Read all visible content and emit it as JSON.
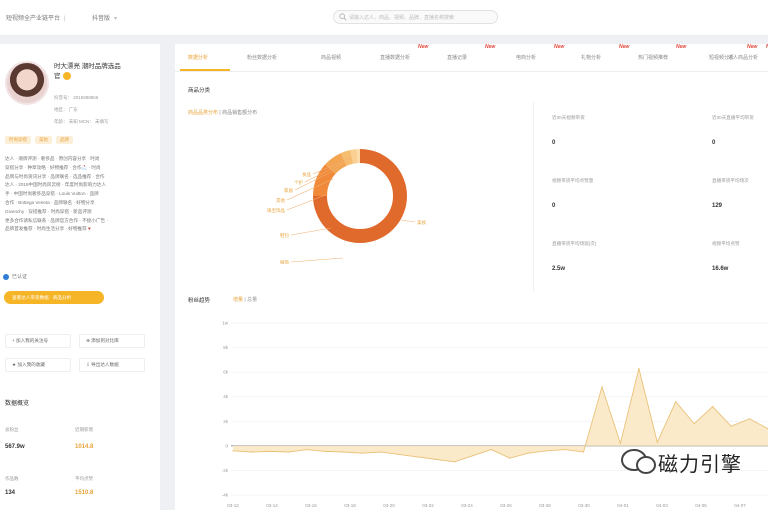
{
  "topbar": {
    "crumbs": [
      "短视频全产业链平台",
      "抖音版"
    ],
    "search_placeholder": "请输入达人、商品、视频、品牌、直播名称搜索"
  },
  "profile": {
    "name": "时大漂亮 潮时品牌选品",
    "name_tail": "官",
    "meta1": "抖音号：  2016888866",
    "meta2": "地区：  广东",
    "meta3": "年龄：  未知   MCN：  未填写",
    "tags": [
      "时尚穿搭",
      "美妆",
      "品牌"
    ],
    "bio": [
      "达人 · 潮牌评测 · 奢侈品 · 原创内容分享 · 时尚",
      "穿搭分享 · 种草攻略 · 好物推荐 · 合作📩 · 时尚",
      "品牌与时尚资讯分享 · 品牌联名 · 选品推荐 · 合作",
      "达人 · 2019中国时尚风云榜 · 年度时尚影响力达人",
      "手 · 中国时尚奢侈品穿搭 · Louis Vuitton · 品牌",
      "合作 · Bottega Veneta · 品牌联名 · 好物分享",
      "Givenchy · 穿搭推荐 · 时尚穿搭 · 新品评测",
      "更多合作请私信联系 · 品牌官方合作 · 不接小广告 ·",
      "品牌首发推荐 · 时尚生活分享 · 好物推荐"
    ],
    "verified": "已认证",
    "orange_button": "查看达人带货数据 · 商品分析",
    "actions": [
      "加入我的关注号",
      "添加到对比库",
      "加入我的收藏",
      "导出达人数据"
    ],
    "overview_title": "数据概览",
    "stats": [
      {
        "label": "总粉丝",
        "value": "567.9w"
      },
      {
        "label": "近期新增",
        "value": "1014.8"
      },
      {
        "label": "作品数",
        "value": "134"
      },
      {
        "label": "平均点赞",
        "value": "1510.8"
      }
    ]
  },
  "main": {
    "tabs": [
      {
        "label": "数据分析",
        "new": false
      },
      {
        "label": "粉丝数据分析",
        "new": false
      },
      {
        "label": "商品视频",
        "new": false
      },
      {
        "label": "直播数据分析",
        "new": true
      },
      {
        "label": "直播记录",
        "new": true
      },
      {
        "label": "电商分析",
        "new": true
      },
      {
        "label": "礼物分析",
        "new": true
      },
      {
        "label": "热门视频推荐",
        "new": true
      },
      {
        "label": "短视频分析",
        "new": true
      },
      {
        "label": "达人商品分析",
        "new": true
      }
    ],
    "new_label": "New",
    "section_title": "商品分类",
    "ring_caption_hl": "商品品类分布",
    "ring_caption_rest": " | 商品销售额分布",
    "donut_labels": [
      "美妆",
      "服饰",
      "鞋包",
      "珠宝饰品",
      "其他",
      "家居",
      "个护",
      "食品"
    ],
    "stats": [
      {
        "label": "近30天视频带货",
        "value": "0"
      },
      {
        "label": "近30天直播平均带货",
        "value": "0"
      },
      {
        "label": "视频带货平均点赞量",
        "value": "0"
      },
      {
        "label": "直播带货平均场次",
        "value": "129"
      },
      {
        "label": "直播带货平均场观(次)",
        "value": "2.5w"
      },
      {
        "label": "视频平均点赞",
        "value": "16.6w"
      }
    ],
    "trend_title": "粉丝趋势",
    "trend_sub_hl": "增量",
    "trend_sub_rest": " | 总量",
    "watermark": "磁力引擎"
  },
  "colors": {
    "accent": "#f5b526",
    "accent_text": "#e8a33a",
    "donut_main": "#e46a2a",
    "trend_fill": "#fbe8c3",
    "trend_line": "#e9c27a",
    "new_badge": "#e0453a"
  },
  "chart_data": {
    "type": "area",
    "title": "",
    "xlabel": "",
    "ylabel": "",
    "x": [
      "03-10",
      "03-12",
      "03-14",
      "03-16",
      "03-18",
      "03-20",
      "03-22",
      "03-24",
      "03-26",
      "03-28",
      "03-30",
      "04-01",
      "04-03",
      "04-05",
      "04-07",
      "04-09",
      "04-11",
      "04-13",
      "04-15",
      "04-17",
      "04-19",
      "04-21",
      "04-23",
      "04-25",
      "04-27",
      "04-29",
      "05-01",
      "05-03",
      "05-05",
      "05-07"
    ],
    "yticks": [
      "1w",
      "8k",
      "6k",
      "4k",
      "2k",
      "0",
      "-2k",
      "-4k"
    ],
    "xticks": [
      "03-12",
      "03-14",
      "03-16",
      "03-18",
      "03-20",
      "03-22",
      "03-24",
      "03-26",
      "03-28",
      "03-30",
      "04-01",
      "04-03",
      "04-05",
      "04-07"
    ],
    "ylim": [
      -4000,
      12000
    ],
    "series": [
      {
        "values": [
          -400,
          -500,
          -450,
          -500,
          -300,
          -450,
          -500,
          -600,
          -500,
          -700,
          -900,
          -1100,
          -1300,
          -800,
          -300,
          -1000,
          -600,
          -400,
          -300,
          -500,
          4800,
          200,
          6300,
          300,
          3600,
          1800,
          3200,
          1600,
          2200,
          1400
        ]
      }
    ],
    "grid": true,
    "legend": "none"
  }
}
